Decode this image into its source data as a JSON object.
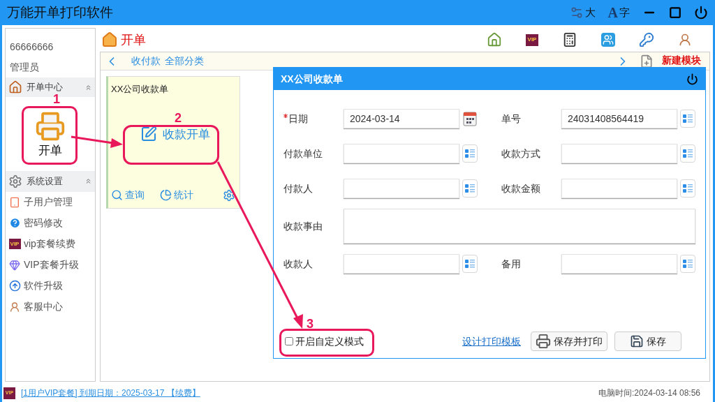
{
  "window": {
    "title": "万能开单打印软件",
    "font_buttons": [
      "大",
      "字"
    ],
    "font_glyph": "A"
  },
  "badges": {
    "sidebar": "VIP",
    "toolbar": "VIP",
    "status_bar": "VIP"
  },
  "user": {
    "id": "66666666",
    "role": "管理员"
  },
  "sidebar": {
    "sections": [
      {
        "title": "开单中心",
        "expanded": true,
        "tiles": [
          {
            "label": "开单"
          }
        ]
      },
      {
        "title": "系统设置",
        "expanded": true,
        "items": [
          {
            "label": "子用户管理"
          },
          {
            "label": "密码修改"
          },
          {
            "label": "vip套餐续费"
          },
          {
            "label": "VIP套餐升级"
          },
          {
            "label": "软件升级"
          },
          {
            "label": "客服中心"
          }
        ]
      }
    ]
  },
  "page": {
    "title": "开单",
    "breadcrumb": [
      "收付款",
      "全部分类"
    ],
    "new_module": "新建模块"
  },
  "module_card": {
    "title": "XX公司收款单",
    "action": "收款开单",
    "links": [
      "查询",
      "统计"
    ]
  },
  "dialog": {
    "title": "XX公司收款单",
    "fields": [
      {
        "label": "日期",
        "value": "2024-03-14",
        "required": true,
        "kind": "date"
      },
      {
        "label": "单号",
        "value": "24031408564419",
        "required": false,
        "kind": "picker"
      },
      {
        "label": "付款单位",
        "required": false,
        "kind": "picker"
      },
      {
        "label": "收款方式",
        "required": false,
        "kind": "picker"
      },
      {
        "label": "付款人",
        "required": false,
        "kind": "picker"
      },
      {
        "label": "收款金额",
        "required": false,
        "kind": "picker"
      },
      {
        "label": "收款事由",
        "required": false,
        "kind": "textarea"
      },
      {
        "label": "收款人",
        "required": false,
        "kind": "picker"
      },
      {
        "label": "备用",
        "required": false,
        "kind": "picker"
      }
    ],
    "custom_mode": {
      "label": "开启自定义模式",
      "checked": false
    },
    "design_link": "设计打印模板",
    "buttons": [
      "保存并打印",
      "保存"
    ]
  },
  "status_bar": {
    "vip": "[1用户VIP套餐] 到期日期：2025-03-17 【续费】",
    "time": "电脑时间:2024-03-14 08:56"
  },
  "annotations": [
    "1",
    "2",
    "3"
  ]
}
